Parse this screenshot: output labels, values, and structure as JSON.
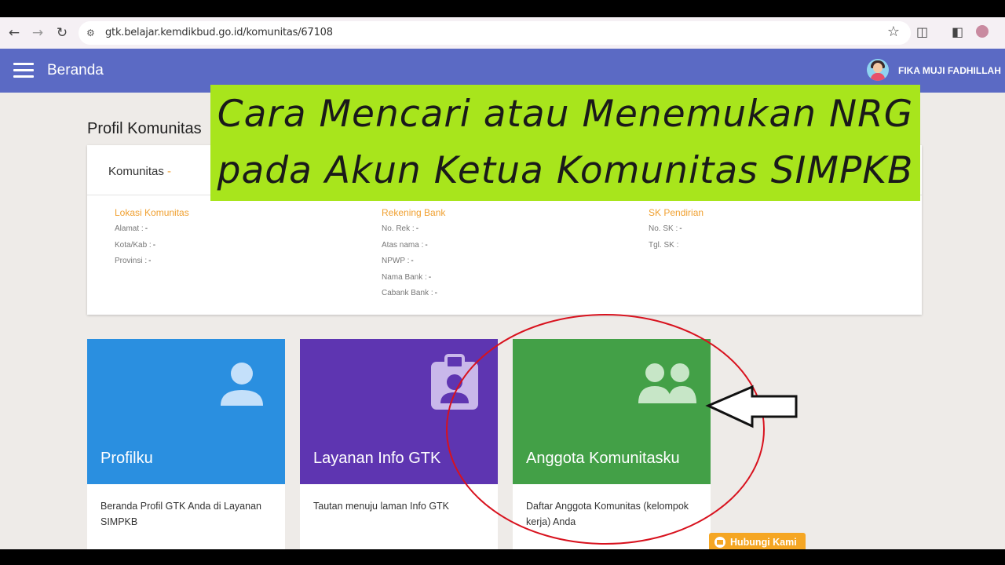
{
  "browser": {
    "url": "gtk.belajar.kemdikbud.go.id/komunitas/67108"
  },
  "appbar": {
    "title": "Beranda",
    "user_name": "FIKA MUJI FADHILLAH"
  },
  "page": {
    "section_title": "Profil Komunitas",
    "komunitas_label": "Komunitas",
    "komunitas_value": "-"
  },
  "banner": {
    "line1": "Cara Mencari atau Menemukan NRG",
    "line2": "pada Akun Ketua Komunitas SIMPKB",
    "bg_color": "#a8e51c"
  },
  "lokasi": {
    "title": "Lokasi Komunitas",
    "fields": [
      {
        "label": "Alamat :",
        "value": "-"
      },
      {
        "label": "Kota/Kab :",
        "value": "-"
      },
      {
        "label": "Provinsi :",
        "value": "-"
      }
    ]
  },
  "rekening": {
    "title": "Rekening Bank",
    "fields": [
      {
        "label": "No. Rek :",
        "value": "-"
      },
      {
        "label": "Atas nama :",
        "value": "-"
      },
      {
        "label": "NPWP :",
        "value": "-"
      },
      {
        "label": "Nama Bank :",
        "value": "-"
      },
      {
        "label": "Cabank Bank :",
        "value": "-"
      }
    ]
  },
  "sk": {
    "title": "SK Pendirian",
    "fields": [
      {
        "label": "No. SK :",
        "value": "-"
      },
      {
        "label": "Tgl. SK :",
        "value": ""
      }
    ]
  },
  "tiles": [
    {
      "title": "Profilku",
      "desc": "Beranda Profil GTK Anda di Layanan SIMPKB",
      "color": "#2a8fe0",
      "icon": "person-icon"
    },
    {
      "title": "Layanan Info GTK",
      "desc": "Tautan menuju laman Info GTK",
      "color": "#5e35b1",
      "icon": "badge-icon"
    },
    {
      "title": "Anggota Komunitasku",
      "desc": "Daftar Anggota Komunitas (kelompok kerja) Anda",
      "color": "#43a047",
      "icon": "group-icon"
    }
  ],
  "contact_button": "Hubungi Kami",
  "annotation_color": "#d8121e"
}
